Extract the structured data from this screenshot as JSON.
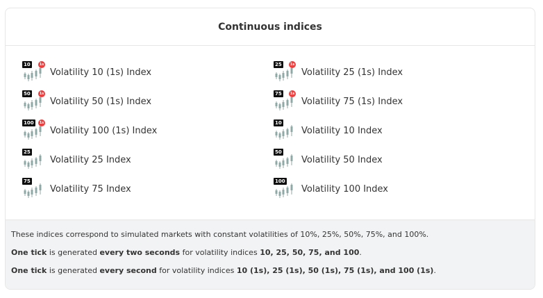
{
  "header": {
    "title": "Continuous indices"
  },
  "indices": [
    {
      "badge": "10",
      "one_second": "1s",
      "label": "Volatility 10 (1s) Index"
    },
    {
      "badge": "25",
      "one_second": "1s",
      "label": "Volatility 25 (1s) Index"
    },
    {
      "badge": "50",
      "one_second": "1s",
      "label": "Volatility 50 (1s) Index"
    },
    {
      "badge": "75",
      "one_second": "1s",
      "label": "Volatility 75 (1s) Index"
    },
    {
      "badge": "100",
      "one_second": "1s",
      "label": "Volatility 100 (1s) Index"
    },
    {
      "badge": "10",
      "one_second": null,
      "label": "Volatility 10 Index"
    },
    {
      "badge": "25",
      "one_second": null,
      "label": "Volatility 25 Index"
    },
    {
      "badge": "50",
      "one_second": null,
      "label": "Volatility 50 Index"
    },
    {
      "badge": "75",
      "one_second": null,
      "label": "Volatility 75 Index"
    },
    {
      "badge": "100",
      "one_second": null,
      "label": "Volatility 100 Index"
    }
  ],
  "footer": {
    "line1": "These indices correspond to simulated markets with constant volatilities of 10%, 25%, 50%, 75%, and 100%.",
    "line2": {
      "a": "One tick",
      "b": " is generated ",
      "c": "every two seconds",
      "d": " for volatility indices ",
      "e": "10, 25, 50, 75, and 100",
      "f": "."
    },
    "line3": {
      "a": "One tick",
      "b": " is generated ",
      "c": "every second",
      "d": " for volatility indices ",
      "e": "10 (1s), 25 (1s), 50 (1s), 75 (1s), and 100 (1s)",
      "f": "."
    }
  },
  "colors": {
    "candle": "#8fa9a6",
    "badge_bg": "#0e0e0e",
    "one_second_badge": "#ec3f3f",
    "footer_bg": "#f2f3f4",
    "border": "#e6e6e6"
  },
  "icons": {
    "market": "candlestick-chart-icon"
  }
}
